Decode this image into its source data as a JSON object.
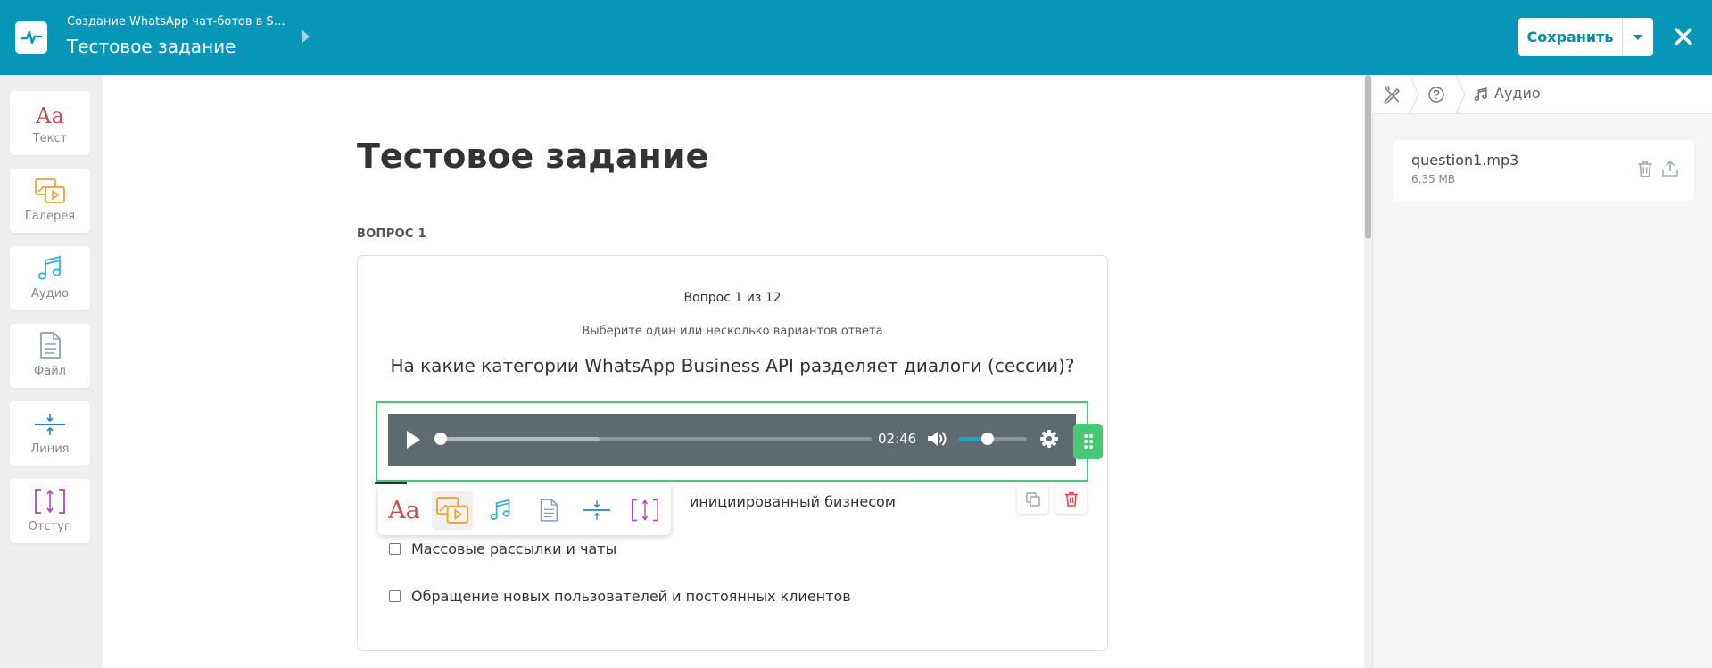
{
  "header": {
    "breadcrumb": "Создание WhatsApp чат-ботов в Sen...",
    "title": "Тестовое задание",
    "save_label": "Сохранить"
  },
  "toolbox": [
    {
      "label": "Текст",
      "icon": "text-aa-icon"
    },
    {
      "label": "Галерея",
      "icon": "gallery-icon"
    },
    {
      "label": "Аудио",
      "icon": "music-note-icon"
    },
    {
      "label": "Файл",
      "icon": "file-icon"
    },
    {
      "label": "Линия",
      "icon": "divider-line-icon"
    },
    {
      "label": "Отступ",
      "icon": "spacing-icon"
    }
  ],
  "page": {
    "title": "Тестовое задание",
    "section_label": "ВОПРОС 1"
  },
  "question": {
    "counter": "Вопрос 1 из 12",
    "hint": "Выберите один или несколько вариантов ответа",
    "text": "На какие категории WhatsApp Business API разделяет диалоги (сессии)?",
    "answers": [
      "инициированный бизнесом",
      "Массовые рассылки и чаты",
      "Обращение новых пользователей и постоянных клиентов"
    ]
  },
  "player": {
    "time": "02:46",
    "progress": 0.0,
    "buffered": 0.37,
    "volume": 0.42
  },
  "insert_menu": {
    "text_label": "Aa",
    "active_item": "gallery"
  },
  "right_panel": {
    "active_tab": "Аудио",
    "file_name": "question1.mp3",
    "file_size": "6.35 MB"
  },
  "colors": {
    "header_bg": "#0697b8",
    "accent_green": "#48c774",
    "player_bg": "#5f6a70",
    "delete_red": "#e04b4b"
  }
}
